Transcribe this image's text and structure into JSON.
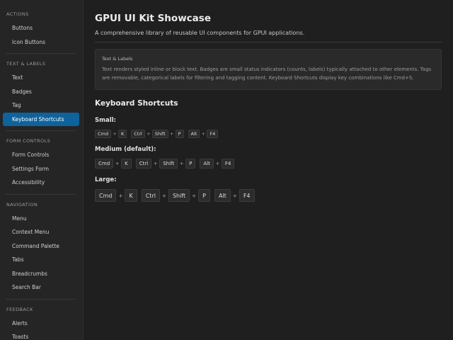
{
  "sidebar": {
    "sections": [
      {
        "title": "ACTIONS",
        "items": [
          "Buttons",
          "Icon Buttons"
        ]
      },
      {
        "title": "TEXT & LABELS",
        "items": [
          "Text",
          "Badges",
          "Tag",
          "Keyboard Shortcuts"
        ]
      },
      {
        "title": "FORM CONTROLS",
        "items": [
          "Form Controls",
          "Settings Form",
          "Accessibility"
        ]
      },
      {
        "title": "NAVIGATION",
        "items": [
          "Menu",
          "Context Menu",
          "Command Palette",
          "Tabs",
          "Breadcrumbs",
          "Search Bar"
        ]
      },
      {
        "title": "FEEDBACK",
        "items": [
          "Alerts",
          "Toasts"
        ]
      }
    ],
    "active_item": "Keyboard Shortcuts",
    "active_color": "#0e639c"
  },
  "main": {
    "title": "GPUI UI Kit Showcase",
    "subtitle": "A comprehensive library of reusable UI components for GPUI applications.",
    "info_card": {
      "title": "Text & Labels",
      "text": "Text renders styled inline or block text. Badges are small status indicators (counts, labels) typically attached to other elements. Tags are removable, categorical labels for filtering and tagging content. Keyboard Shortcuts display key combinations like Cmd+S."
    },
    "section_heading": "Keyboard Shortcuts",
    "plus": "+",
    "shortcut_groups": [
      {
        "label": "Small:",
        "size": "sm",
        "combos": [
          [
            "Cmd",
            "K"
          ],
          [
            "Ctrl",
            "Shift",
            "P"
          ],
          [
            "Alt",
            "F4"
          ]
        ]
      },
      {
        "label": "Medium (default):",
        "size": "md",
        "combos": [
          [
            "Cmd",
            "K"
          ],
          [
            "Ctrl",
            "Shift",
            "P"
          ],
          [
            "Alt",
            "F4"
          ]
        ]
      },
      {
        "label": "Large:",
        "size": "lg",
        "combos": [
          [
            "Cmd",
            "K"
          ],
          [
            "Ctrl",
            "Shift",
            "P"
          ],
          [
            "Alt",
            "F4"
          ]
        ]
      }
    ]
  }
}
